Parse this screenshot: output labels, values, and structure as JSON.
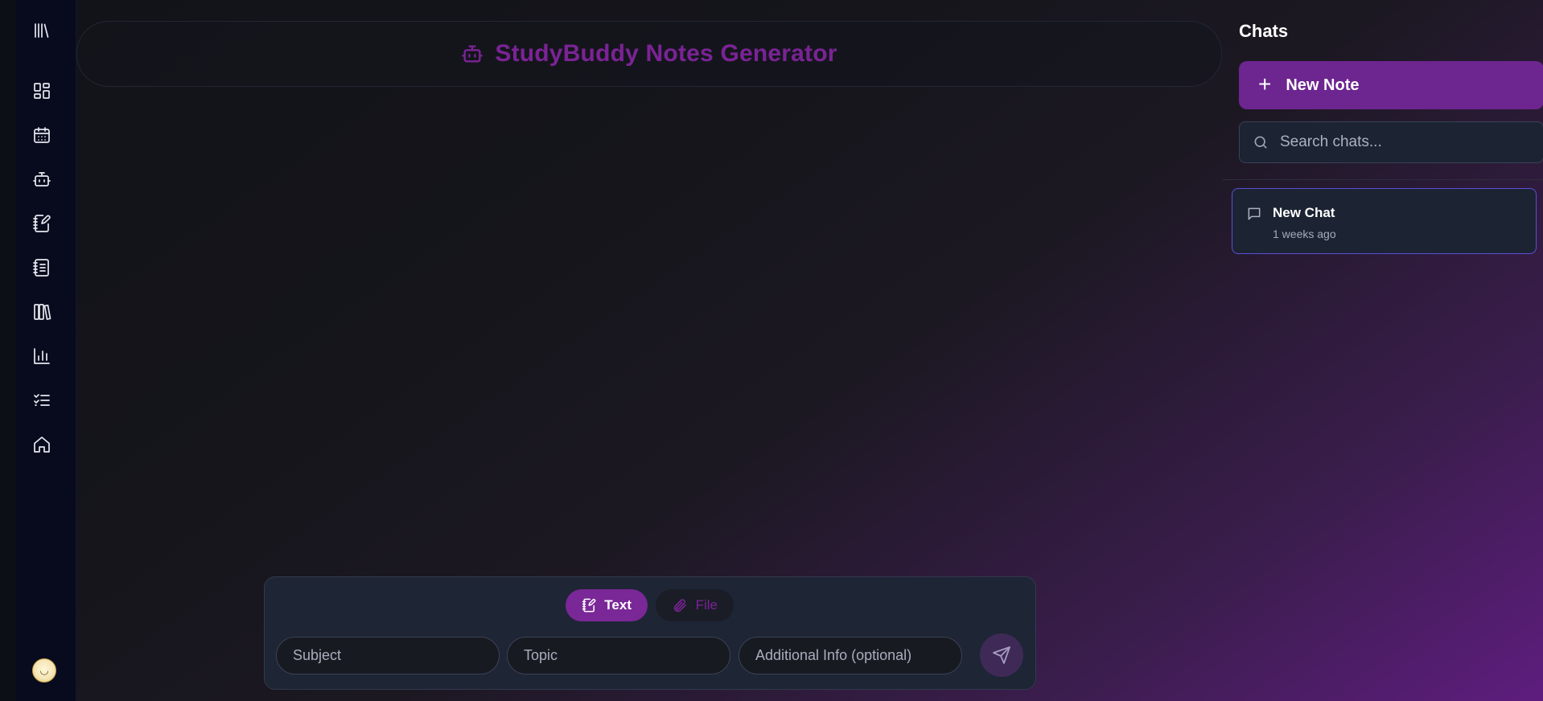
{
  "header": {
    "title": "StudyBuddy Notes Generator",
    "icon": "bot-icon",
    "accent_color": "#7b2396"
  },
  "nav": {
    "items": [
      {
        "icon": "library-icon"
      },
      {
        "icon": "dashboard-icon"
      },
      {
        "icon": "calendar-icon"
      },
      {
        "icon": "bot-icon"
      },
      {
        "icon": "notebook-pen-icon"
      },
      {
        "icon": "notebook-icon"
      },
      {
        "icon": "books-icon"
      },
      {
        "icon": "bar-chart-icon"
      },
      {
        "icon": "checklist-icon"
      },
      {
        "icon": "home-icon"
      }
    ],
    "avatar": "user-avatar"
  },
  "sidebar": {
    "title": "Chats",
    "new_note_label": "New Note",
    "search_placeholder": "Search chats...",
    "chats": [
      {
        "name": "New Chat",
        "time": "1 weeks ago"
      }
    ]
  },
  "composer": {
    "modes": [
      {
        "label": "Text",
        "active": true
      },
      {
        "label": "File",
        "active": false
      }
    ],
    "subject_placeholder": "Subject",
    "topic_placeholder": "Topic",
    "info_placeholder": "Additional Info (optional)"
  },
  "colors": {
    "primary": "#6d2590",
    "rail_bg": "#070b1d",
    "panel_bg": "#1c2333",
    "selected_border": "#5b50d6"
  }
}
